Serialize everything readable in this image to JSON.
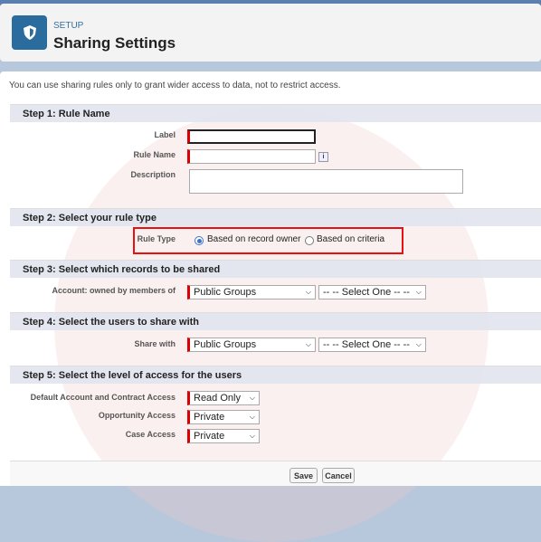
{
  "header": {
    "eyebrow": "SETUP",
    "title": "Sharing Settings",
    "icon": "shield-icon"
  },
  "info_text": "You can use sharing rules only to grant wider access to data, not to restrict access.",
  "step1": {
    "title": "Step 1: Rule Name",
    "label": "Label",
    "label_value": "",
    "rule_name": "Rule Name",
    "rule_name_value": "",
    "description": "Description",
    "description_value": "",
    "info_icon": "i"
  },
  "step2": {
    "title": "Step 2: Select your rule type",
    "rule_type": "Rule Type",
    "options": [
      {
        "label": "Based on record owner",
        "selected": true
      },
      {
        "label": "Based on criteria",
        "selected": false
      }
    ],
    "highlight_color": "#e81010"
  },
  "step3": {
    "title": "Step 3: Select which records to be shared",
    "label": "Account: owned by members of",
    "select1": "Public Groups",
    "select2": "-- -- Select One -- --"
  },
  "step4": {
    "title": "Step 4: Select the users to share with",
    "label": "Share with",
    "select1": "Public Groups",
    "select2": "-- -- Select One -- --"
  },
  "step5": {
    "title": "Step 5: Select the level of access for the users",
    "rows": [
      {
        "label": "Default Account and Contract Access",
        "value": "Read Only"
      },
      {
        "label": "Opportunity Access",
        "value": "Private"
      },
      {
        "label": "Case Access",
        "value": "Private"
      }
    ]
  },
  "buttons": {
    "save": "Save",
    "cancel": "Cancel"
  }
}
